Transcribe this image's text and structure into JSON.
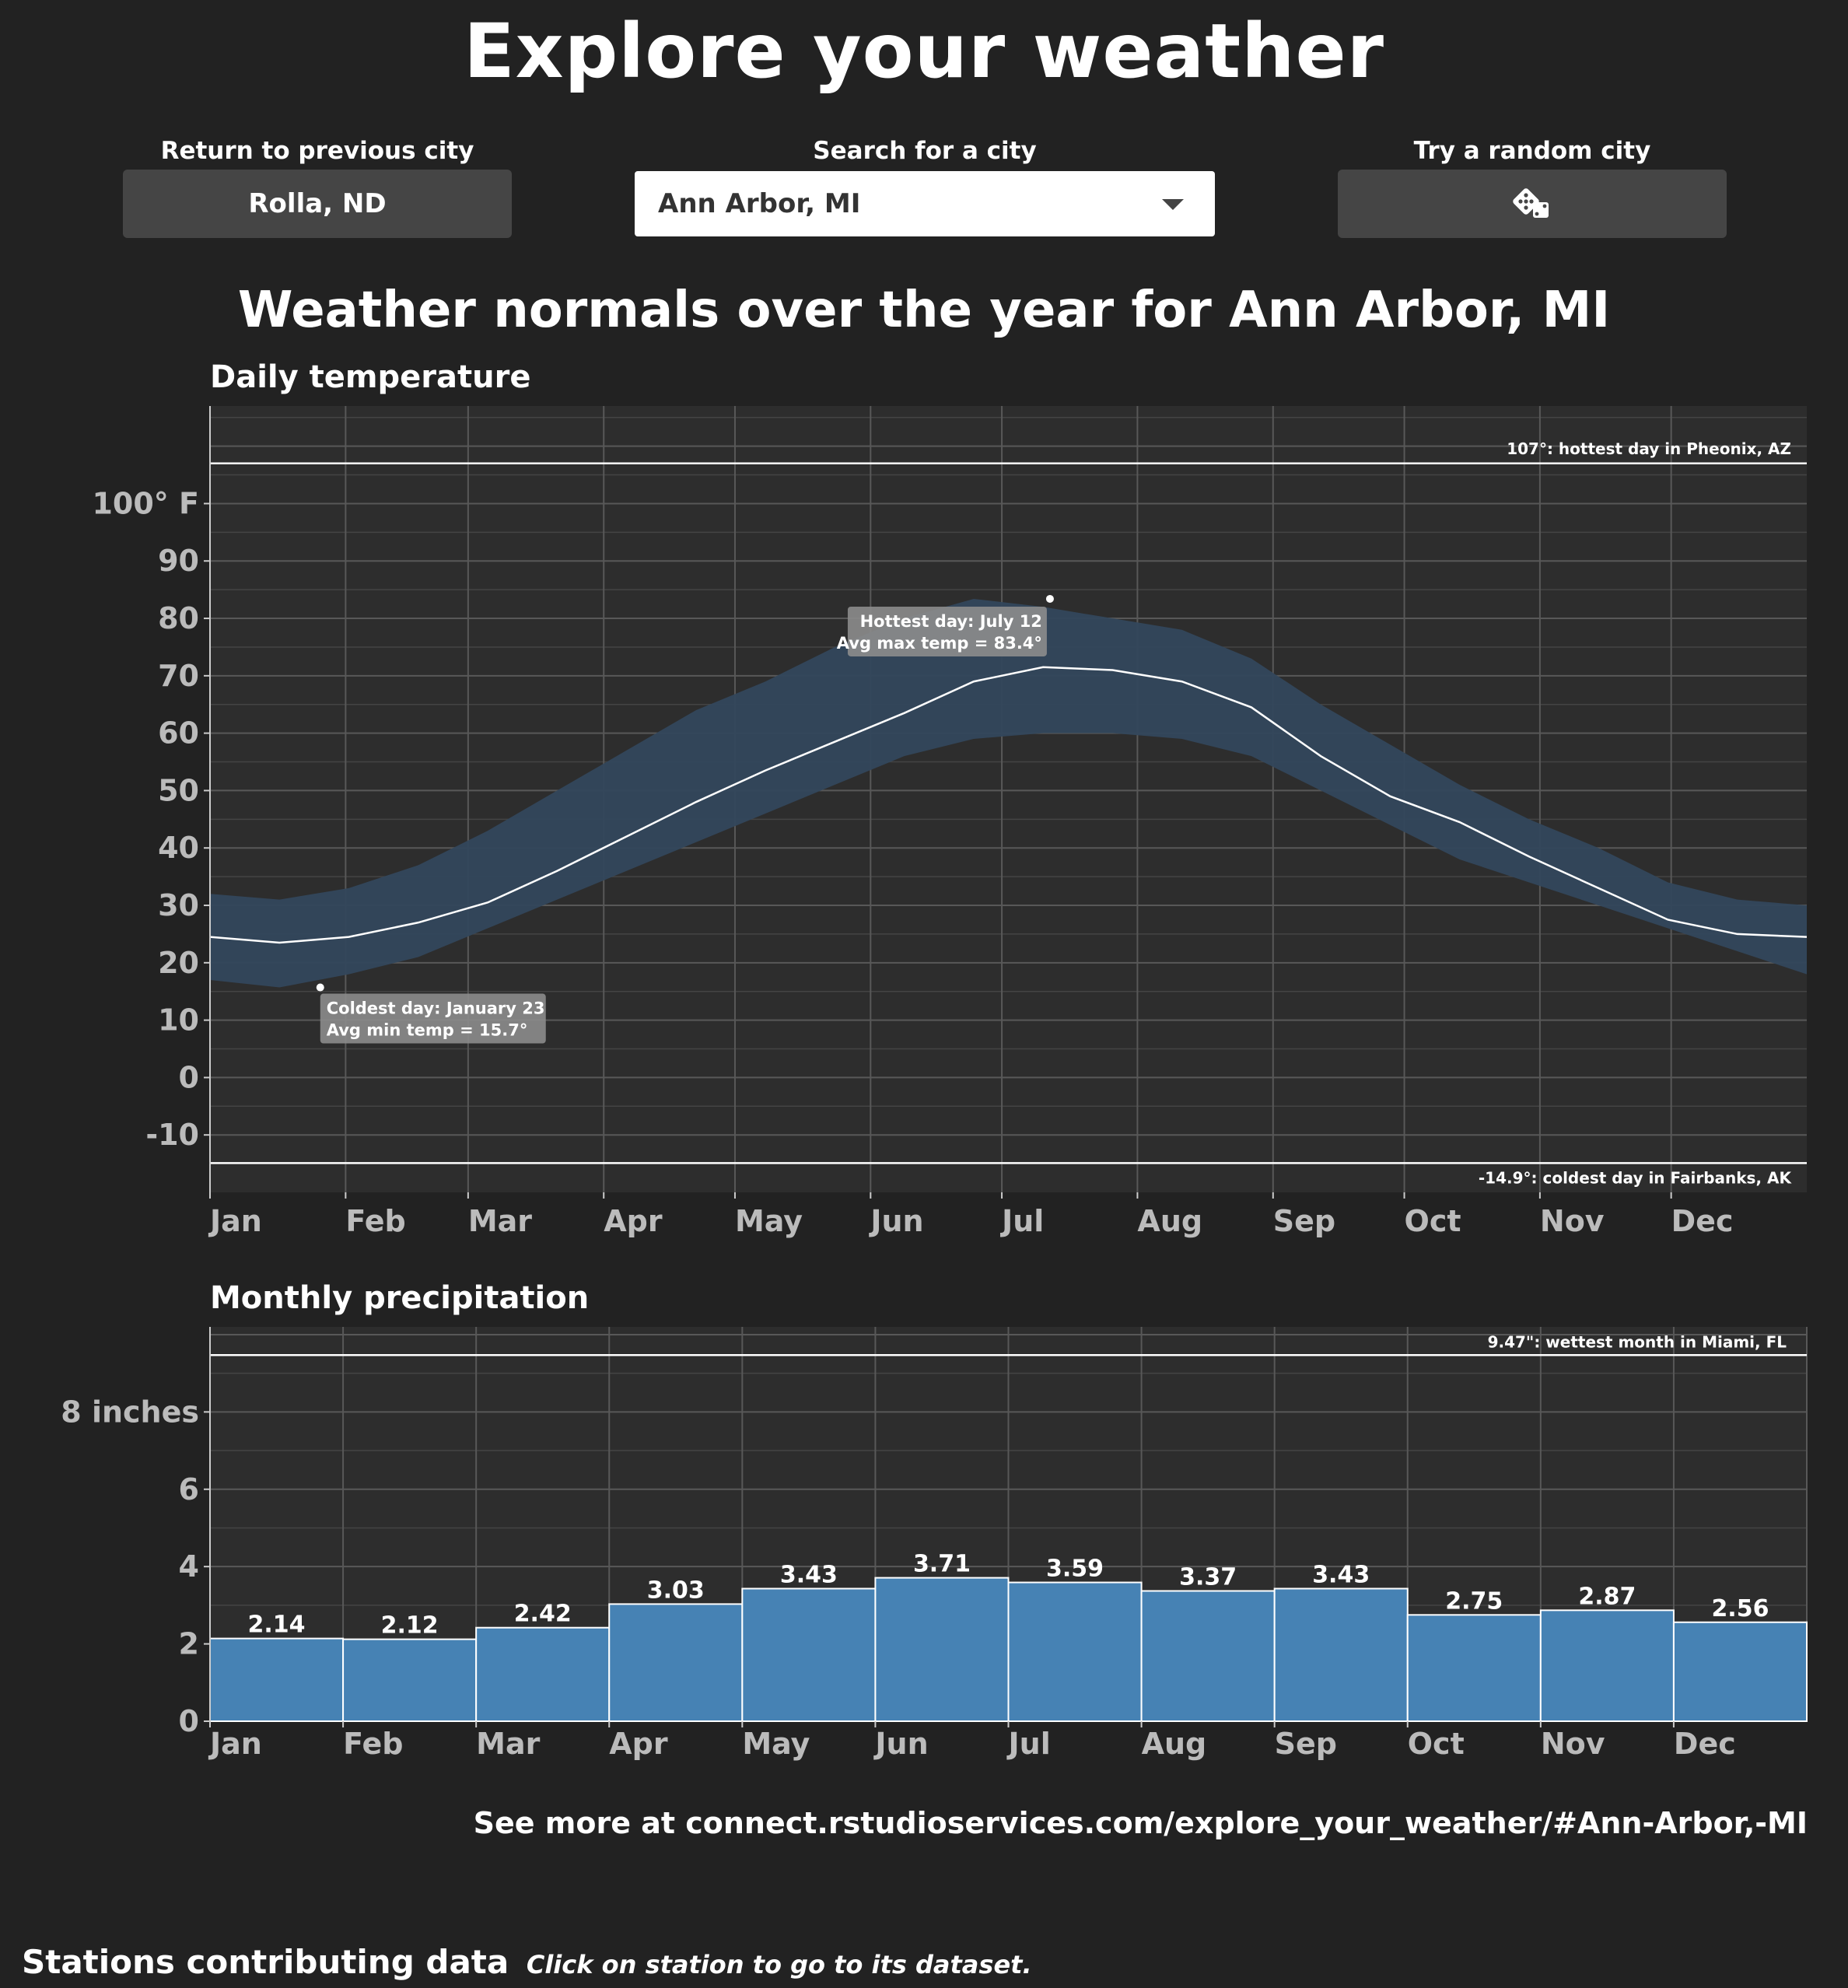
{
  "page": {
    "title": "Explore your weather",
    "subtitle": "Weather normals over the year for Ann Arbor, MI",
    "see_more": "See more at connect.rstudioservices.com/explore_your_weather/#Ann-Arbor,-MI",
    "stations_title": "Stations contributing data",
    "stations_note": "Click on station to go to its dataset."
  },
  "controls": {
    "prev_label": "Return to previous city",
    "prev_value": "Rolla, ND",
    "search_label": "Search for a city",
    "search_value": "Ann Arbor, MI",
    "random_label": "Try a random city",
    "random_icon": "dice-icon"
  },
  "colors": {
    "background": "#222222",
    "panel": "#2d2d2d",
    "band": "#33475c",
    "bar": "#4682b4",
    "line": "#ffffff"
  },
  "chart_data": [
    {
      "type": "area",
      "title": "Daily temperature",
      "x_ticks": [
        "Jan",
        "Feb",
        "Mar",
        "Apr",
        "May",
        "Jun",
        "Jul",
        "Aug",
        "Sep",
        "Oct",
        "Nov",
        "Dec"
      ],
      "y_ticks": [
        "100° F",
        "90",
        "80",
        "70",
        "60",
        "50",
        "40",
        "30",
        "20",
        "10",
        "0",
        "-10"
      ],
      "y_tick_values": [
        100,
        90,
        80,
        70,
        60,
        50,
        40,
        30,
        20,
        10,
        0,
        -10
      ],
      "ylim": [
        -20,
        117
      ],
      "grid": true,
      "series": [
        {
          "values_min": [
            17,
            15.7,
            18,
            21,
            26,
            31,
            36,
            41,
            46,
            51,
            56,
            59,
            60,
            60,
            59,
            56,
            50,
            44,
            38,
            34,
            30,
            26,
            22,
            18
          ],
          "values_max": [
            32,
            31,
            33,
            37,
            43,
            50,
            57,
            64,
            69,
            75,
            80,
            83.4,
            82,
            80,
            78,
            73,
            65,
            58,
            51,
            45,
            40,
            34,
            31,
            30
          ],
          "values_mean": [
            24.5,
            23.5,
            24.5,
            27,
            30.5,
            36,
            42,
            48,
            53.5,
            58.5,
            63.5,
            69,
            71.5,
            71,
            69,
            64.5,
            56,
            49,
            44.5,
            38.5,
            33,
            27.5,
            25,
            24.5
          ]
        }
      ],
      "annotations": {
        "hottest": {
          "label1": "Hottest day: July 12",
          "label2": "Avg max temp = 83.4°",
          "day_of_year": 193,
          "value": 83.4
        },
        "coldest": {
          "label1": "Coldest day: January 23",
          "label2": "Avg min temp = 15.7°",
          "day_of_year": 23,
          "value": 15.7
        },
        "record_high": {
          "value": 107,
          "label": "107°: hottest day in Pheonix, AZ"
        },
        "record_low": {
          "value": -14.9,
          "label": "-14.9°: coldest day in Fairbanks, AK"
        }
      }
    },
    {
      "type": "bar",
      "title": "Monthly precipitation",
      "categories": [
        "Jan",
        "Feb",
        "Mar",
        "Apr",
        "May",
        "Jun",
        "Jul",
        "Aug",
        "Sep",
        "Oct",
        "Nov",
        "Dec"
      ],
      "values": [
        2.14,
        2.12,
        2.42,
        3.03,
        3.43,
        3.71,
        3.59,
        3.37,
        3.43,
        2.75,
        2.87,
        2.56
      ],
      "value_labels": [
        "2.14",
        "2.12",
        "2.42",
        "3.03",
        "3.43",
        "3.71",
        "3.59",
        "3.37",
        "3.43",
        "2.75",
        "2.87",
        "2.56"
      ],
      "y_ticks": [
        "8 inches",
        "6",
        "4",
        "2",
        "0"
      ],
      "y_tick_values": [
        8,
        6,
        4,
        2,
        0
      ],
      "ylim": [
        0,
        10.2
      ],
      "grid": true,
      "annotations": {
        "record_wet": {
          "value": 9.47,
          "label": "9.47\": wettest month in Miami, FL"
        }
      }
    }
  ]
}
